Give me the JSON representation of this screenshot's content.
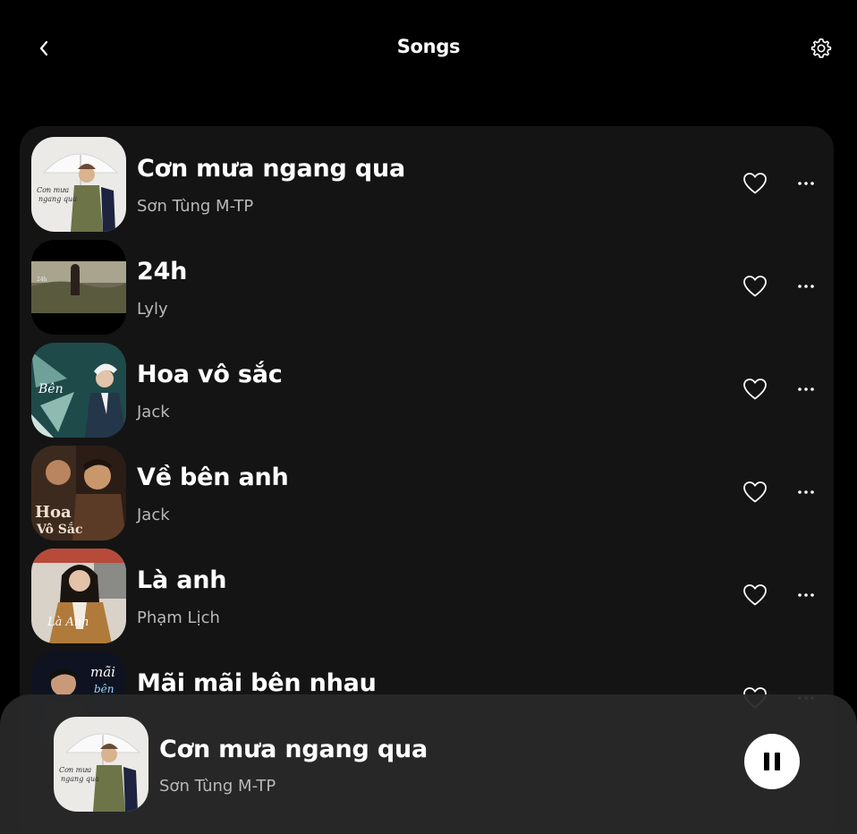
{
  "header": {
    "title": "Songs",
    "back_icon": "chevron-left-icon",
    "settings_icon": "gear-icon"
  },
  "songs": [
    {
      "title": "Cơn mưa ngang qua",
      "artist": "Sơn Tùng M-TP"
    },
    {
      "title": "24h",
      "artist": "Lyly"
    },
    {
      "title": "Hoa vô sắc",
      "artist": "Jack"
    },
    {
      "title": "Về bên anh",
      "artist": "Jack"
    },
    {
      "title": "Là anh",
      "artist": "Phạm Lịch"
    },
    {
      "title": "Mãi mãi bên nhau",
      "artist": ""
    }
  ],
  "now_playing": {
    "title": "Cơn mưa ngang qua",
    "artist": "Sơn Tùng M-TP",
    "state": "playing",
    "control_icon": "pause-icon"
  },
  "colors": {
    "background": "#000000",
    "panel": "#141414",
    "player_bar": "#282828",
    "text_primary": "#ffffff",
    "text_secondary": "#b9b9b9"
  }
}
